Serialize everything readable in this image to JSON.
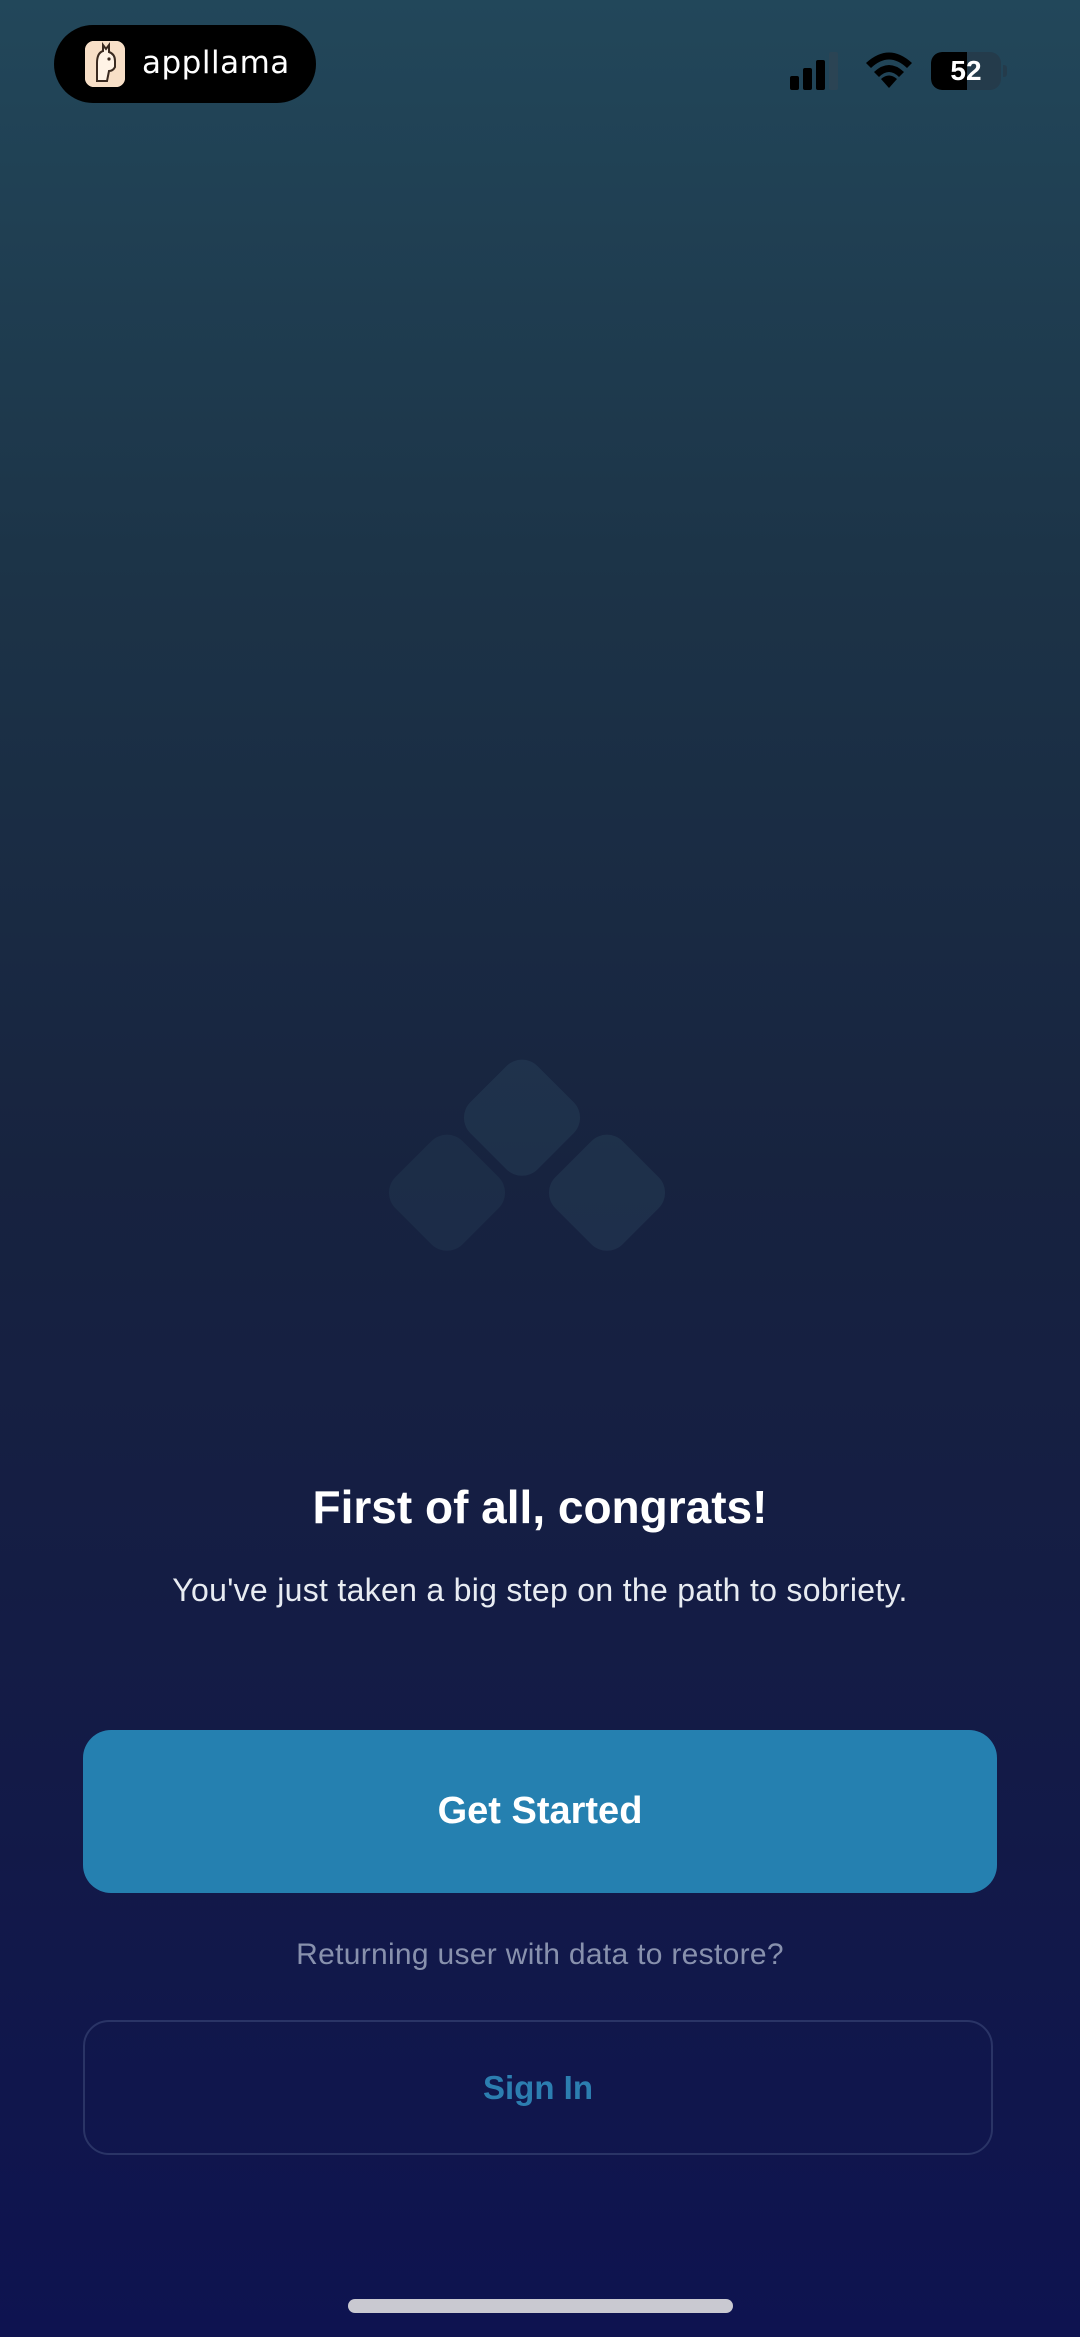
{
  "status_bar": {
    "app_badge": "appllama",
    "battery_level": "52",
    "battery_fraction": 0.52,
    "icons": [
      "app-logo-icon",
      "signal-icon",
      "wifi-icon",
      "battery-icon"
    ]
  },
  "hero": {
    "logo_icon": "diamond-cluster-logo-icon"
  },
  "welcome": {
    "title": "First of all, congrats!",
    "subtitle": "You've just taken a big step on the path to sobriety."
  },
  "actions": {
    "get_started_label": "Get Started",
    "returning_prompt": "Returning user with data to restore?",
    "sign_in_label": "Sign In"
  },
  "colors": {
    "primary_button": "#2580b0",
    "sign_in_text": "#2c7eb0",
    "background_top": "#22475a",
    "background_bottom": "#0e1350"
  }
}
